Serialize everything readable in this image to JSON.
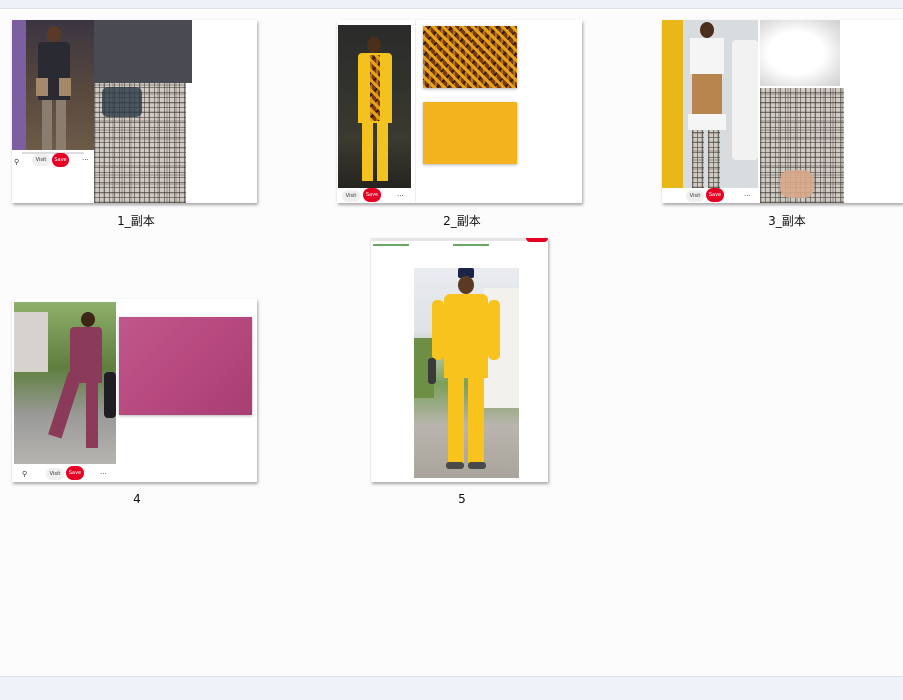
{
  "files": [
    {
      "name": "1_副本"
    },
    {
      "name": "2_副本"
    },
    {
      "name": "3_副本"
    },
    {
      "name": "4"
    },
    {
      "name": "5"
    }
  ],
  "pin": {
    "visit_label": "Visit",
    "save_label": "Save",
    "more_label": "···"
  },
  "colors": {
    "pinterest_red": "#e60023",
    "mustard_yellow": "#f3b31e",
    "magenta_fabric": "#b7497f",
    "charcoal_fabric": "#4a4a52"
  }
}
